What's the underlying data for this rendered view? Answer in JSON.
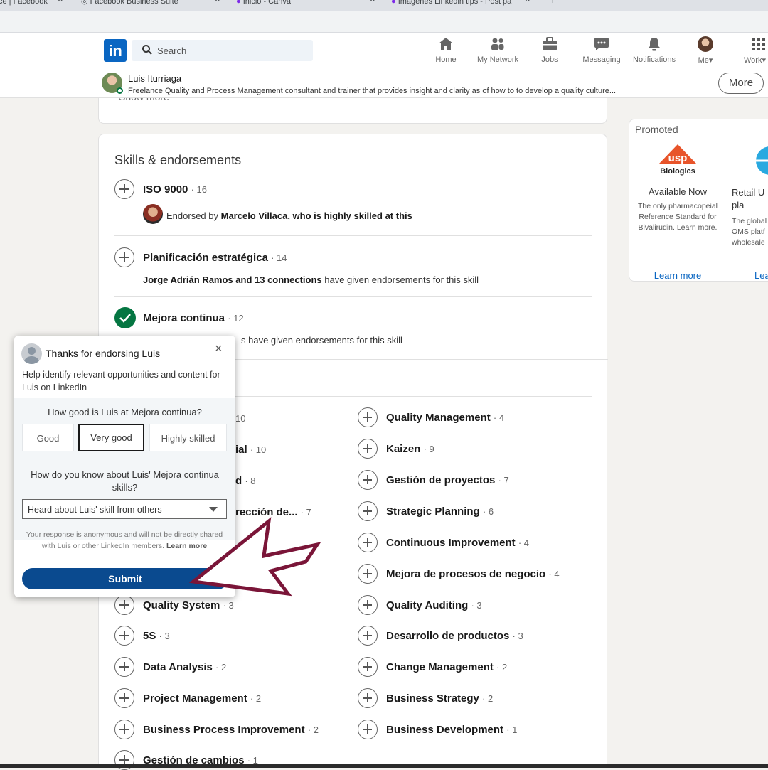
{
  "browser": {
    "tabs": [
      {
        "title": "ce | Facebook"
      },
      {
        "title": "Facebook Business Suite"
      },
      {
        "title": "Inicio - Canva"
      },
      {
        "title": "Imágenes Linkedin tips - Post pa"
      }
    ]
  },
  "nav": {
    "logo": "in",
    "search_placeholder": "Search",
    "items": [
      {
        "label": "Home",
        "icon": "home-icon"
      },
      {
        "label": "My Network",
        "icon": "network-icon"
      },
      {
        "label": "Jobs",
        "icon": "briefcase-icon"
      },
      {
        "label": "Messaging",
        "icon": "messaging-icon"
      },
      {
        "label": "Notifications",
        "icon": "bell-icon"
      },
      {
        "label": "Me",
        "icon": "avatar"
      },
      {
        "label": "Work",
        "icon": "grid-icon"
      }
    ]
  },
  "profile_bar": {
    "name": "Luis Iturriaga",
    "headline": "Freelance Quality and Process Management consultant and trainer that provides insight and clarity as of how to to develop a quality culture...",
    "more_label": "More",
    "prev_section_link": "Show more"
  },
  "skills": {
    "title": "Skills & endorsements",
    "top": [
      {
        "name": "ISO 9000",
        "count": "· 16",
        "endorser": "Marcelo Villaca, who is highly skilled at this",
        "prefix": "Endorsed by ",
        "endorsed": false
      },
      {
        "name": "Planificación estratégica",
        "count": "· 14",
        "bold": "Jorge Adrián Ramos and 13 connections",
        "rest": " have given endorsements for this skill",
        "endorsed": false
      },
      {
        "name": "Mejora continua",
        "count": "· 12",
        "rest": "s have given endorsements for this skill",
        "endorsed": true
      }
    ],
    "left_partial": [
      {
        "name": "",
        "count": "10"
      },
      {
        "name": "ial",
        "count": "· 10"
      },
      {
        "name": "d",
        "count": "· 8"
      },
      {
        "name": "rección de...",
        "count": "· 7"
      }
    ],
    "left": [
      {
        "name": "Quality System",
        "count": "· 3"
      },
      {
        "name": "5S",
        "count": "· 3"
      },
      {
        "name": "Data Analysis",
        "count": "· 2"
      },
      {
        "name": "Project Management",
        "count": "· 2"
      },
      {
        "name": "Business Process Improvement",
        "count": "· 2"
      },
      {
        "name": "Gestión de cambios",
        "count": "· 1"
      }
    ],
    "right": [
      {
        "name": "Quality Management",
        "count": "· 4"
      },
      {
        "name": "Kaizen",
        "count": "· 9"
      },
      {
        "name": "Gestión de proyectos",
        "count": "· 7"
      },
      {
        "name": "Strategic Planning",
        "count": "· 6"
      },
      {
        "name": "Continuous Improvement",
        "count": "· 4"
      },
      {
        "name": "Mejora de procesos de negocio",
        "count": "· 4"
      },
      {
        "name": "Quality Auditing",
        "count": "· 3"
      },
      {
        "name": "Desarrollo de productos",
        "count": "· 3"
      },
      {
        "name": "Change Management",
        "count": "· 2"
      },
      {
        "name": "Business Strategy",
        "count": "· 2"
      },
      {
        "name": "Business Development",
        "count": "· 1"
      }
    ]
  },
  "promoted": {
    "label": "Promoted",
    "ads": [
      {
        "logo_mark": "usp",
        "logo_text": "Biologics",
        "headline": "Available Now",
        "desc": "The only pharmacopeial Reference Standard for Bivalirudin. Learn more.",
        "cta": "Learn more"
      },
      {
        "headline": "Retail U pla",
        "desc": "The global OMS platf wholesale",
        "cta": "Lea"
      }
    ]
  },
  "popup": {
    "title": "Thanks for endorsing Luis",
    "close": "×",
    "description": "Help identify relevant opportunities and content for Luis on LinkedIn",
    "question1": "How good is Luis at Mejora continua?",
    "ratings": [
      "Good",
      "Very good",
      "Highly skilled"
    ],
    "selected_rating": "Very good",
    "question2": "How do you know about Luis' Mejora continua skills?",
    "relation_value": "Heard about Luis' skill from others",
    "anon_note": "Your response is anonymous and will not be directly shared with Luis or other LinkedIn members.",
    "learn_more": "Learn more",
    "submit_label": "Submit"
  },
  "annotation": {
    "arrow_color": "#7a1538"
  }
}
